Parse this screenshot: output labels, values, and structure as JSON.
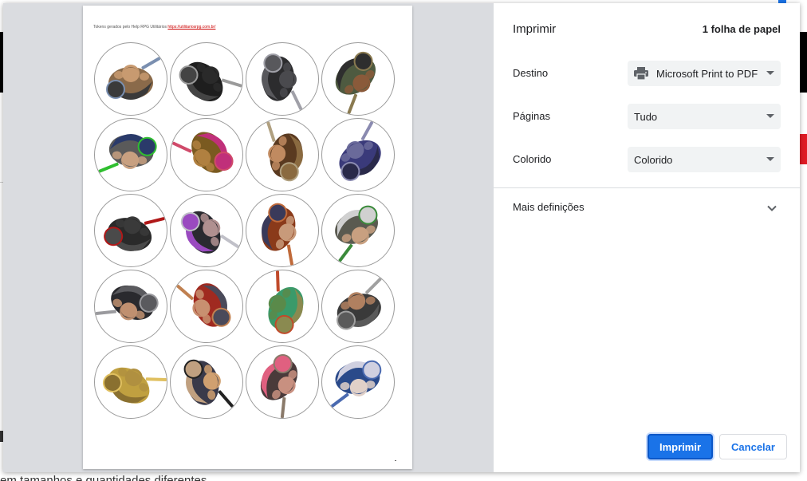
{
  "print_dialog": {
    "title": "Imprimir",
    "sheet_count": "1 folha de papel",
    "destination": {
      "label": "Destino",
      "value": "Microsoft Print to PDF",
      "icon": "printer-icon"
    },
    "pages": {
      "label": "Páginas",
      "value": "Tudo"
    },
    "color": {
      "label": "Colorido",
      "value": "Colorido"
    },
    "more_settings": {
      "label": "Mais definições",
      "icon": "chevron-down-icon"
    },
    "print_button": "Imprimir",
    "cancel_button": "Cancelar",
    "accent_color": "#1a73e8"
  },
  "preview": {
    "header_text": "Tokens gerados pelo Help RPG Utilitários",
    "header_link": "https://utilitariosrpg.com.br/",
    "tokens": [
      {
        "primary": "#8a6a4a",
        "secondary": "#3a3a3a",
        "accent": "#7a8fb0",
        "skin": "#c89a70"
      },
      {
        "primary": "#1e1e1e",
        "secondary": "#444444",
        "accent": "#9a9a9a",
        "skin": "#2a2a2a"
      },
      {
        "primary": "#2c2c2e",
        "secondary": "#58585c",
        "accent": "#a0a0a8",
        "skin": "#4a4a4e"
      },
      {
        "primary": "#4e5a40",
        "secondary": "#2e2e2e",
        "accent": "#8a7a50",
        "skin": "#8a5a3a"
      },
      {
        "primary": "#5a5a5a",
        "secondary": "#2a3a6a",
        "accent": "#2fbf2f",
        "skin": "#c8a080"
      },
      {
        "primary": "#7a5a20",
        "secondary": "#c0307a",
        "accent": "#d04a6a",
        "skin": "#b08040"
      },
      {
        "primary": "#5a3a20",
        "secondary": "#8a6a40",
        "accent": "#b0a080",
        "skin": "#c08a60"
      },
      {
        "primary": "#3a3a7a",
        "secondary": "#2a2a4a",
        "accent": "#8a8ab0",
        "skin": "#6a6a9a"
      },
      {
        "primary": "#2a2a2a",
        "secondary": "#4a4a4a",
        "accent": "#b01818",
        "skin": "#3a3a3a"
      },
      {
        "primary": "#2a2a30",
        "secondary": "#9a4ac0",
        "accent": "#c0c0c8",
        "skin": "#b09090"
      },
      {
        "primary": "#8a3a1a",
        "secondary": "#3a3a5a",
        "accent": "#c06a3a",
        "skin": "#c89a7a"
      },
      {
        "primary": "#5a5a50",
        "secondary": "#d0d0d0",
        "accent": "#3a8a3a",
        "skin": "#c8a080"
      },
      {
        "primary": "#2a2a2e",
        "secondary": "#5a5a5e",
        "accent": "#9a9a9e",
        "skin": "#c09070"
      },
      {
        "primary": "#a02a20",
        "secondary": "#4a4a5a",
        "accent": "#c08050",
        "skin": "#c89070"
      },
      {
        "primary": "#3a9a6a",
        "secondary": "#8a8a50",
        "accent": "#c04a2a",
        "skin": "#5a8a4a"
      },
      {
        "primary": "#3a3a3a",
        "secondary": "#5a5a5a",
        "accent": "#a0a0a0",
        "skin": "#b08060"
      },
      {
        "primary": "#c0a040",
        "secondary": "#8a7030",
        "accent": "#e0c060",
        "skin": "#b09040"
      },
      {
        "primary": "#3a3a4a",
        "secondary": "#c0a080",
        "accent": "#222222",
        "skin": "#d0a070"
      },
      {
        "primary": "#4a3a3a",
        "secondary": "#e06080",
        "accent": "#8a7a6a",
        "skin": "#c89080"
      },
      {
        "primary": "#2a4a8a",
        "secondary": "#d0d0e0",
        "accent": "#4a6ab0",
        "skin": "#e0d0c8"
      }
    ]
  },
  "background": {
    "bottom_text": "em tamanhos e quantidades diferentes"
  }
}
